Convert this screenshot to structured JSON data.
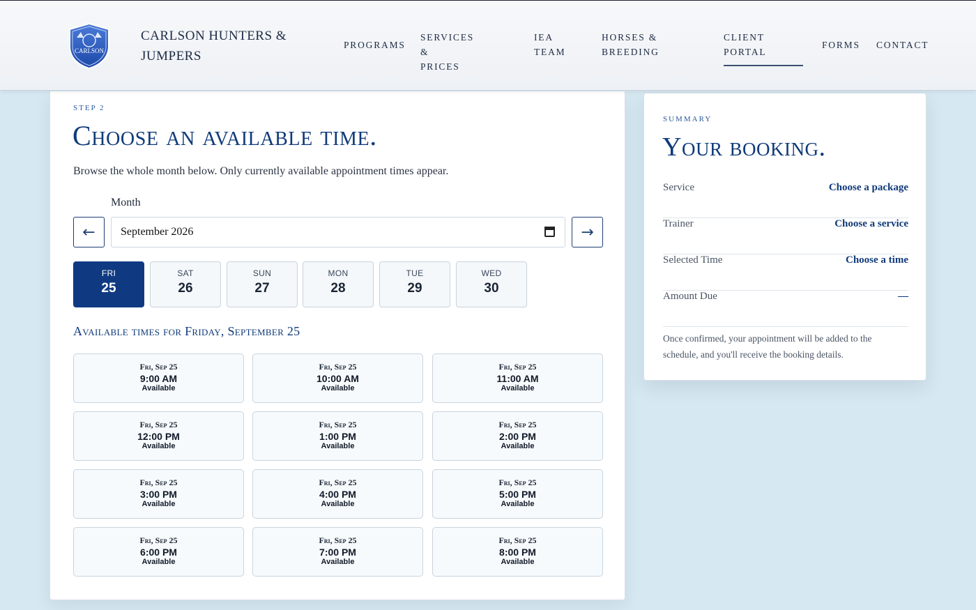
{
  "header": {
    "brand_line1": "CARLSON HUNTERS &",
    "brand_line2": "JUMPERS",
    "crest_text": "CARLSON",
    "nav": [
      {
        "line1": "PROGRAMS",
        "line2": ""
      },
      {
        "line1": "SERVICES &",
        "line2": "PRICES"
      },
      {
        "line1": "IEA",
        "line2": "TEAM"
      },
      {
        "line1": "HORSES &",
        "line2": "BREEDING"
      },
      {
        "line1": "CLIENT",
        "line2": "PORTAL"
      },
      {
        "line1": "FORMS",
        "line2": ""
      },
      {
        "line1": "CONTACT",
        "line2": ""
      }
    ],
    "active_nav": "CLIENT PORTAL"
  },
  "booking": {
    "step": "STEP 2",
    "title": "Choose an available time.",
    "description": "Browse the whole month below. Only currently available appointment times appear.",
    "month_label": "Month",
    "month_value": "September  2026",
    "prev_arrow": "←",
    "next_arrow": "→",
    "days": [
      {
        "dow": "FRI",
        "num": "25",
        "selected": true
      },
      {
        "dow": "SAT",
        "num": "26",
        "selected": false
      },
      {
        "dow": "SUN",
        "num": "27",
        "selected": false
      },
      {
        "dow": "MON",
        "num": "28",
        "selected": false
      },
      {
        "dow": "TUE",
        "num": "29",
        "selected": false
      },
      {
        "dow": "WED",
        "num": "30",
        "selected": false
      }
    ],
    "available_heading": "Available times for Friday, September 25",
    "slots": [
      {
        "date": "Fri, Sep 25",
        "time": "9:00 AM",
        "status": "Available"
      },
      {
        "date": "Fri, Sep 25",
        "time": "10:00 AM",
        "status": "Available"
      },
      {
        "date": "Fri, Sep 25",
        "time": "11:00 AM",
        "status": "Available"
      },
      {
        "date": "Fri, Sep 25",
        "time": "12:00 PM",
        "status": "Available"
      },
      {
        "date": "Fri, Sep 25",
        "time": "1:00 PM",
        "status": "Available"
      },
      {
        "date": "Fri, Sep 25",
        "time": "2:00 PM",
        "status": "Available"
      },
      {
        "date": "Fri, Sep 25",
        "time": "3:00 PM",
        "status": "Available"
      },
      {
        "date": "Fri, Sep 25",
        "time": "4:00 PM",
        "status": "Available"
      },
      {
        "date": "Fri, Sep 25",
        "time": "5:00 PM",
        "status": "Available"
      },
      {
        "date": "Fri, Sep 25",
        "time": "6:00 PM",
        "status": "Available"
      },
      {
        "date": "Fri, Sep 25",
        "time": "7:00 PM",
        "status": "Available"
      },
      {
        "date": "Fri, Sep 25",
        "time": "8:00 PM",
        "status": "Available"
      }
    ]
  },
  "summary": {
    "eyebrow": "SUMMARY",
    "title": "Your booking.",
    "rows": [
      {
        "key": "Service",
        "value": "Choose a package"
      },
      {
        "key": "Trainer",
        "value": "Choose a service"
      },
      {
        "key": "Selected Time",
        "value": "Choose a time"
      },
      {
        "key": "Amount Due",
        "value": "—"
      }
    ],
    "note": "Once confirmed, your appointment will be added to the schedule, and you'll receive the booking details."
  },
  "colors": {
    "brand_blue": "#0f3a82",
    "accent_blue": "#2c5a9c",
    "page_bg": "#d6e8f1"
  }
}
